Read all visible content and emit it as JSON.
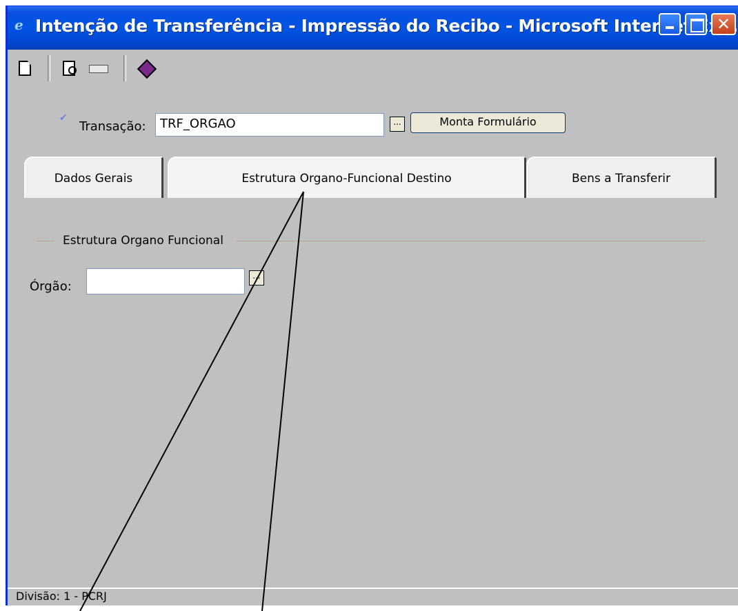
{
  "window": {
    "title": "Intenção de Transferência - Impressão do Recibo - Microsoft Internet Exp...",
    "controls": {
      "minimize": "minimize",
      "maximize": "maximize",
      "close": "✕"
    }
  },
  "toolbar": {
    "icons": [
      "new-document-icon",
      "print-preview-icon",
      "card-icon",
      "help-book-icon"
    ]
  },
  "form": {
    "transacao_label": "Transação:",
    "transacao_value": "TRF_ORGAO",
    "lookup_button": "...",
    "monta_button": "Monta Formulário"
  },
  "tabs": [
    {
      "label": "Dados Gerais",
      "active": false
    },
    {
      "label": "Estrutura Organo-Funcional Destino",
      "active": true
    },
    {
      "label": "Bens a Transferir",
      "active": false
    }
  ],
  "group": {
    "label": "Estrutura Organo Funcional",
    "orgao_label": "Órgão:",
    "orgao_value": "",
    "lookup_button": "..."
  },
  "status": {
    "text": "Divisão: 1 - PCRJ"
  },
  "colors": {
    "titlebar": "#0054e3",
    "background": "#c0c0c0",
    "group_line": "#b5aa84"
  }
}
